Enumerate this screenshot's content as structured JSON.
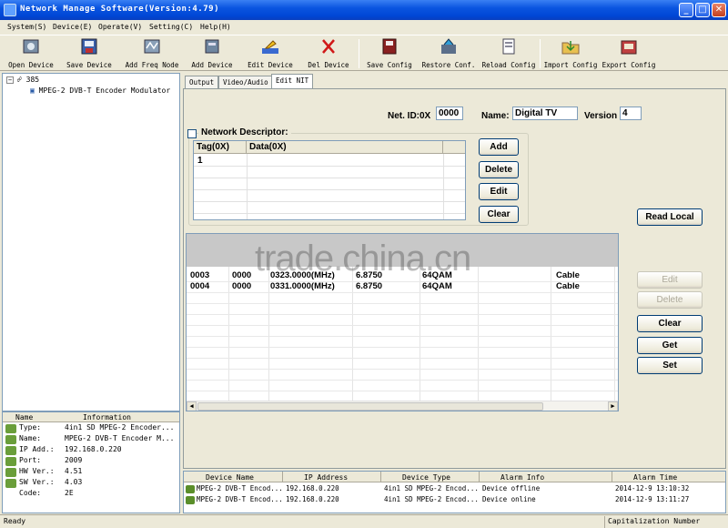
{
  "window": {
    "title": "Network Manage Software(Version:4.79)"
  },
  "menu": [
    "System(S)",
    "Device(E)",
    "Operate(V)",
    "Setting(C)",
    "Help(H)"
  ],
  "toolbar": [
    {
      "label": "Open Device",
      "icon": "open-device-icon"
    },
    {
      "label": "Save Device",
      "icon": "save-device-icon"
    },
    {
      "label": "Add Freq Node",
      "icon": "add-freq-node-icon"
    },
    {
      "label": "Add Device",
      "icon": "add-device-icon"
    },
    {
      "label": "Edit Device",
      "icon": "edit-device-icon"
    },
    {
      "label": "Del Device",
      "icon": "delete-icon"
    },
    {
      "label": "Save Config",
      "icon": "save-config-icon"
    },
    {
      "label": "Restore Conf.",
      "icon": "restore-config-icon"
    },
    {
      "label": "Reload Config",
      "icon": "reload-config-icon"
    },
    {
      "label": "Import Config",
      "icon": "import-config-icon"
    },
    {
      "label": "Export Config",
      "icon": "export-config-icon"
    }
  ],
  "tree": {
    "root": "385",
    "child": "MPEG-2 DVB-T Encoder Modulator"
  },
  "info": {
    "headers": [
      "Name",
      "Information"
    ],
    "rows": [
      {
        "k": "Type:",
        "v": "4in1 SD MPEG-2 Encoder..."
      },
      {
        "k": "Name:",
        "v": "MPEG-2 DVB-T Encoder M..."
      },
      {
        "k": "IP Add.:",
        "v": "192.168.0.220"
      },
      {
        "k": "Port:",
        "v": "2009"
      },
      {
        "k": "HW Ver.:",
        "v": "4.51"
      },
      {
        "k": "SW Ver.:",
        "v": "4.03"
      },
      {
        "k": "Code:",
        "v": "2E"
      }
    ]
  },
  "tabs": [
    "Output",
    "Video/Audio",
    "Edit NIT"
  ],
  "nit": {
    "net_id_label": "Net. ID:0X",
    "net_id_value": "0000",
    "name_label": "Name:",
    "name_value": "Digital TV",
    "version_label": "Version",
    "version_value": "4"
  },
  "descriptor": {
    "label": "Network Descriptor:",
    "headers": [
      "Tag(0X)",
      "Data(0X)"
    ],
    "rows": [
      [
        "1",
        ""
      ]
    ],
    "buttons": [
      "Add",
      "Delete",
      "Edit",
      "Clear"
    ]
  },
  "streams": {
    "rows": [
      [
        "0003",
        "0000",
        "0323.0000(MHz)",
        "6.8750",
        "64QAM",
        "Cable"
      ],
      [
        "0004",
        "0000",
        "0331.0000(MHz)",
        "6.8750",
        "64QAM",
        "Cable"
      ]
    ]
  },
  "side_buttons": {
    "read_local": "Read Local",
    "edit": "Edit",
    "delete": "Delete",
    "clear": "Clear",
    "get": "Get",
    "set": "Set"
  },
  "watermark": "trade.china.cn",
  "log": {
    "headers": [
      "Device Name",
      "IP Address",
      "Device Type",
      "Alarm Info",
      "Alarm Time"
    ],
    "rows": [
      [
        "MPEG-2 DVB-T Encod...",
        "192.168.0.220",
        "4in1 SD MPEG-2 Encod...",
        "Device offline",
        "2014-12-9 13:10:32"
      ],
      [
        "MPEG-2 DVB-T Encod...",
        "192.168.0.220",
        "4in1 SD MPEG-2 Encod...",
        "Device online",
        "2014-12-9 13:11:27"
      ]
    ]
  },
  "status": {
    "left": "Ready",
    "right": "Capitalization Number"
  },
  "colors": {
    "titlebar": "#0a55e0",
    "face": "#ece9d8",
    "border": "#7f9db9"
  }
}
